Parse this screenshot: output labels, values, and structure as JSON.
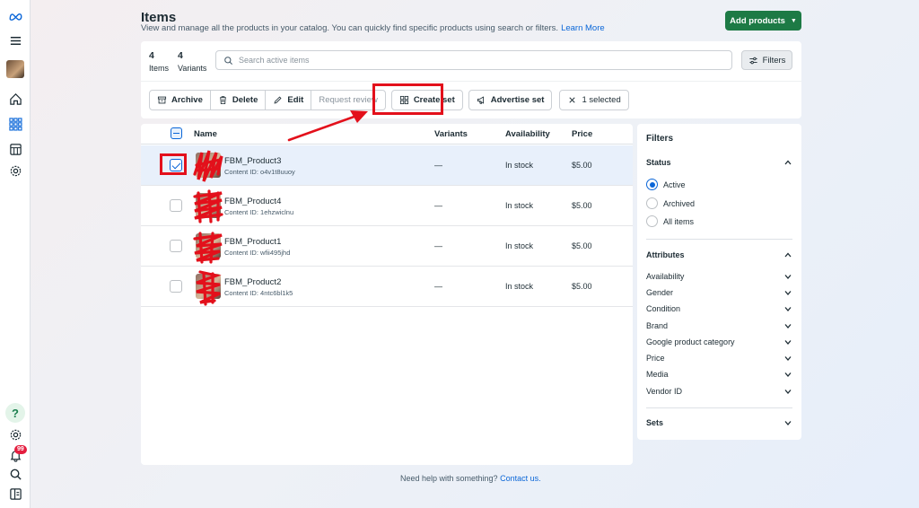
{
  "page": {
    "title": "Items",
    "subtitle": "View and manage all the products in your catalog. You can quickly find specific products using search or filters.",
    "learn_more": "Learn More",
    "add_products": "Add products"
  },
  "sidebar": {
    "icons": [
      "meta-logo-icon",
      "menu-icon",
      "avatar",
      "home-icon",
      "grid-icon",
      "catalog-icon",
      "settings-icon",
      "help-icon",
      "settings-icon",
      "notifications-icon",
      "search-icon",
      "panel-icon"
    ],
    "notification_count": "99",
    "help_glyph": "?"
  },
  "stats": {
    "items_count": "4",
    "items_label": "Items",
    "variants_count": "4",
    "variants_label": "Variants"
  },
  "search": {
    "placeholder": "Search active items"
  },
  "filters_button": "Filters",
  "toolbar": {
    "archive": "Archive",
    "delete": "Delete",
    "edit": "Edit",
    "request_review": "Request review",
    "create_set": "Create set",
    "advertise_set": "Advertise set",
    "selected": "1 selected"
  },
  "table": {
    "columns": [
      "Name",
      "Variants",
      "Availability",
      "Price"
    ],
    "rows": [
      {
        "name": "FBM_Product3",
        "content_id": "Content ID: o4v1t8uuoy",
        "variants": "—",
        "availability": "In stock",
        "price": "$5.00",
        "selected": true
      },
      {
        "name": "FBM_Product4",
        "content_id": "Content ID: 1ehzwiclnu",
        "variants": "—",
        "availability": "In stock",
        "price": "$5.00",
        "selected": false
      },
      {
        "name": "FBM_Product1",
        "content_id": "Content ID: wfii495jhd",
        "variants": "—",
        "availability": "In stock",
        "price": "$5.00",
        "selected": false
      },
      {
        "name": "FBM_Product2",
        "content_id": "Content ID: 4ntc6bl1k5",
        "variants": "—",
        "availability": "In stock",
        "price": "$5.00",
        "selected": false
      }
    ]
  },
  "filter_panel": {
    "title": "Filters",
    "status_label": "Status",
    "status_options": [
      "Active",
      "Archived",
      "All items"
    ],
    "status_selected": "Active",
    "attributes_label": "Attributes",
    "attributes": [
      "Availability",
      "Gender",
      "Condition",
      "Brand",
      "Google product category",
      "Price",
      "Media",
      "Vendor ID"
    ],
    "sets_label": "Sets"
  },
  "footer": {
    "help_text": "Need help with something?",
    "contact_link": "Contact us."
  },
  "colors": {
    "primary_green": "#1d7a45",
    "link_blue": "#0a66d8",
    "annotation_red": "#e3101b"
  }
}
